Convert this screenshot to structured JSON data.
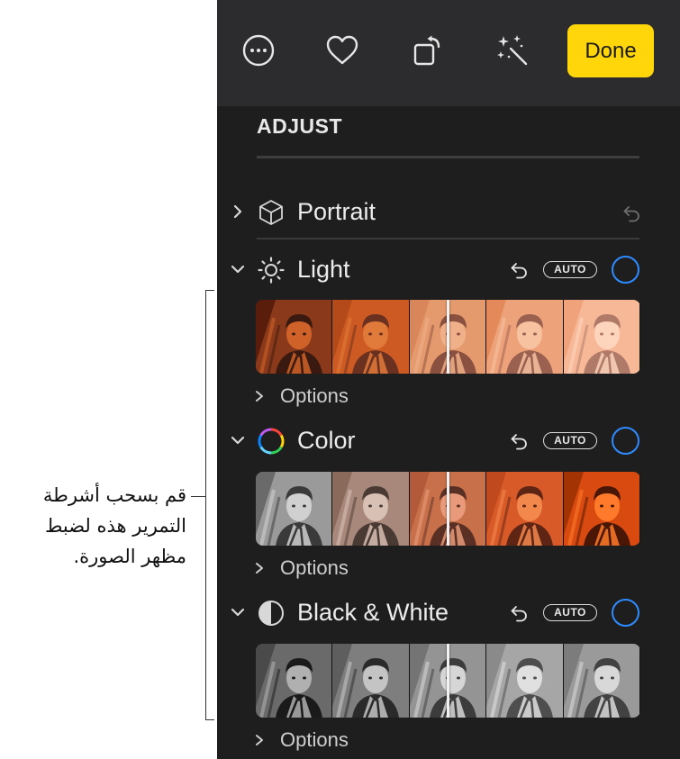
{
  "callout": {
    "text": "قم بسحب أشرطة التمرير هذه لضبط مظهر الصورة."
  },
  "toolbar": {
    "icons": [
      "more-icon",
      "heart-icon",
      "rotate-icon",
      "magic-wand-icon"
    ],
    "done_label": "Done",
    "done_color": "#ffd60a"
  },
  "panel": {
    "title": "ADJUST",
    "sections": [
      {
        "label": "Portrait",
        "expanded": false,
        "icon": "cube-icon"
      },
      {
        "label": "Light",
        "expanded": true,
        "icon": "sun-icon",
        "auto_label": "AUTO",
        "options_label": "Options"
      },
      {
        "label": "Color",
        "expanded": true,
        "icon": "color-wheel-icon",
        "auto_label": "AUTO",
        "options_label": "Options"
      },
      {
        "label": "Black & White",
        "expanded": true,
        "icon": "contrast-icon",
        "auto_label": "AUTO",
        "options_label": "Options"
      }
    ],
    "accent_color": "#2e8bff"
  },
  "strip_palettes": {
    "light": [
      [
        "#5a1d0c",
        "#8a3a1a",
        "#cf6228",
        "#3a1a10"
      ],
      [
        "#b44a1a",
        "#cc5a22",
        "#e07a3a",
        "#6a3020"
      ],
      [
        "#d9875a",
        "#e49a6c",
        "#f0b08a",
        "#8a5040"
      ],
      [
        "#e48a5a",
        "#eea27a",
        "#f6c2a0",
        "#9a6050"
      ],
      [
        "#f0a27a",
        "#f7b898",
        "#fdd4bc",
        "#b07a68"
      ]
    ],
    "color": [
      [
        "#6a6a6a",
        "#9a9a9a",
        "#d0d0d0",
        "#3a3a3a"
      ],
      [
        "#8a6a5a",
        "#a8887a",
        "#d8c0b4",
        "#4a3a34"
      ],
      [
        "#b25a3a",
        "#c8704a",
        "#e89a7a",
        "#5a3024"
      ],
      [
        "#c04a1e",
        "#d85a28",
        "#f2884c",
        "#5e2414"
      ],
      [
        "#a23404",
        "#d84a10",
        "#ff7a2a",
        "#4a1606"
      ]
    ],
    "bw": [
      [
        "#4a4a4a",
        "#6a6a6a",
        "#b0b0b0",
        "#1a1a1a"
      ],
      [
        "#5e5e5e",
        "#7e7e7e",
        "#c4c4c4",
        "#2a2a2a"
      ],
      [
        "#747474",
        "#949494",
        "#d6d6d6",
        "#3c3c3c"
      ],
      [
        "#8a8a8a",
        "#a6a6a6",
        "#e0e0e0",
        "#4e4e4e"
      ],
      [
        "#7c7c7c",
        "#9a9a9a",
        "#d8d8d8",
        "#424242"
      ]
    ]
  }
}
